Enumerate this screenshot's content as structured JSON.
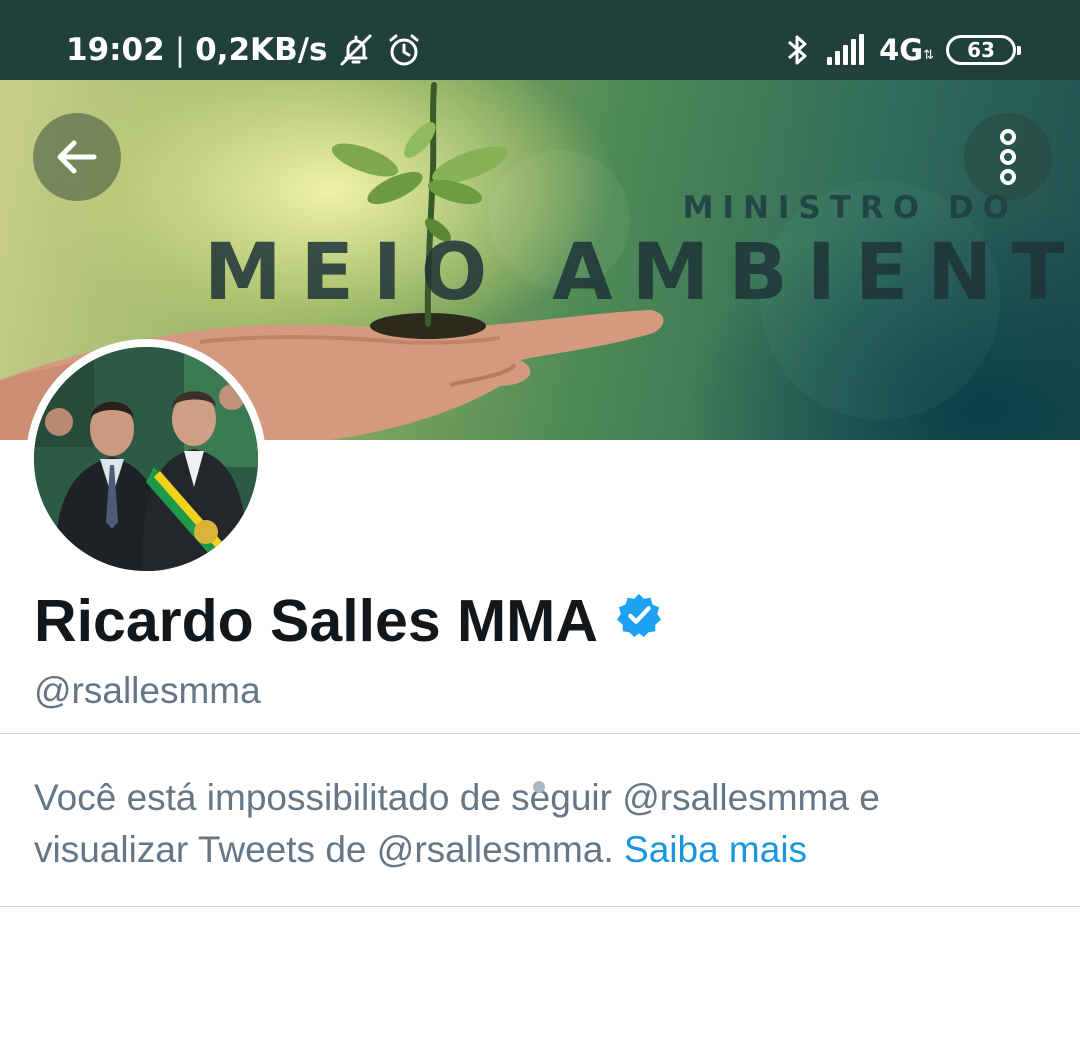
{
  "status_bar": {
    "time": "19:02",
    "separator": "|",
    "network_speed": "0,2KB/s",
    "icons": [
      "notifications-muted-icon",
      "alarm-icon",
      "bluetooth-icon",
      "signal-icon"
    ],
    "network_type": "4G",
    "battery_level": "63"
  },
  "banner": {
    "subtitle": "MINISTRO DO",
    "title": "MEIO AMBIENTE",
    "back_icon": "arrow-left-icon",
    "more_icon": "more-vertical-icon"
  },
  "profile": {
    "display_name": "Ricardo Salles MMA",
    "verified": true,
    "verified_color": "#1da1f2",
    "handle": "@rsallesmma"
  },
  "blocked_notice": {
    "message": "Você está impossibilitado de seguir @rsallesmma e visualizar Tweets de @rsallesmma.",
    "link_label": "Saiba mais",
    "link_color": "#1b95e0"
  },
  "colors": {
    "status_bar_bg": "#213f3b",
    "text_primary": "#14171a",
    "text_secondary": "#657786",
    "divider": "#ccd6dd"
  }
}
